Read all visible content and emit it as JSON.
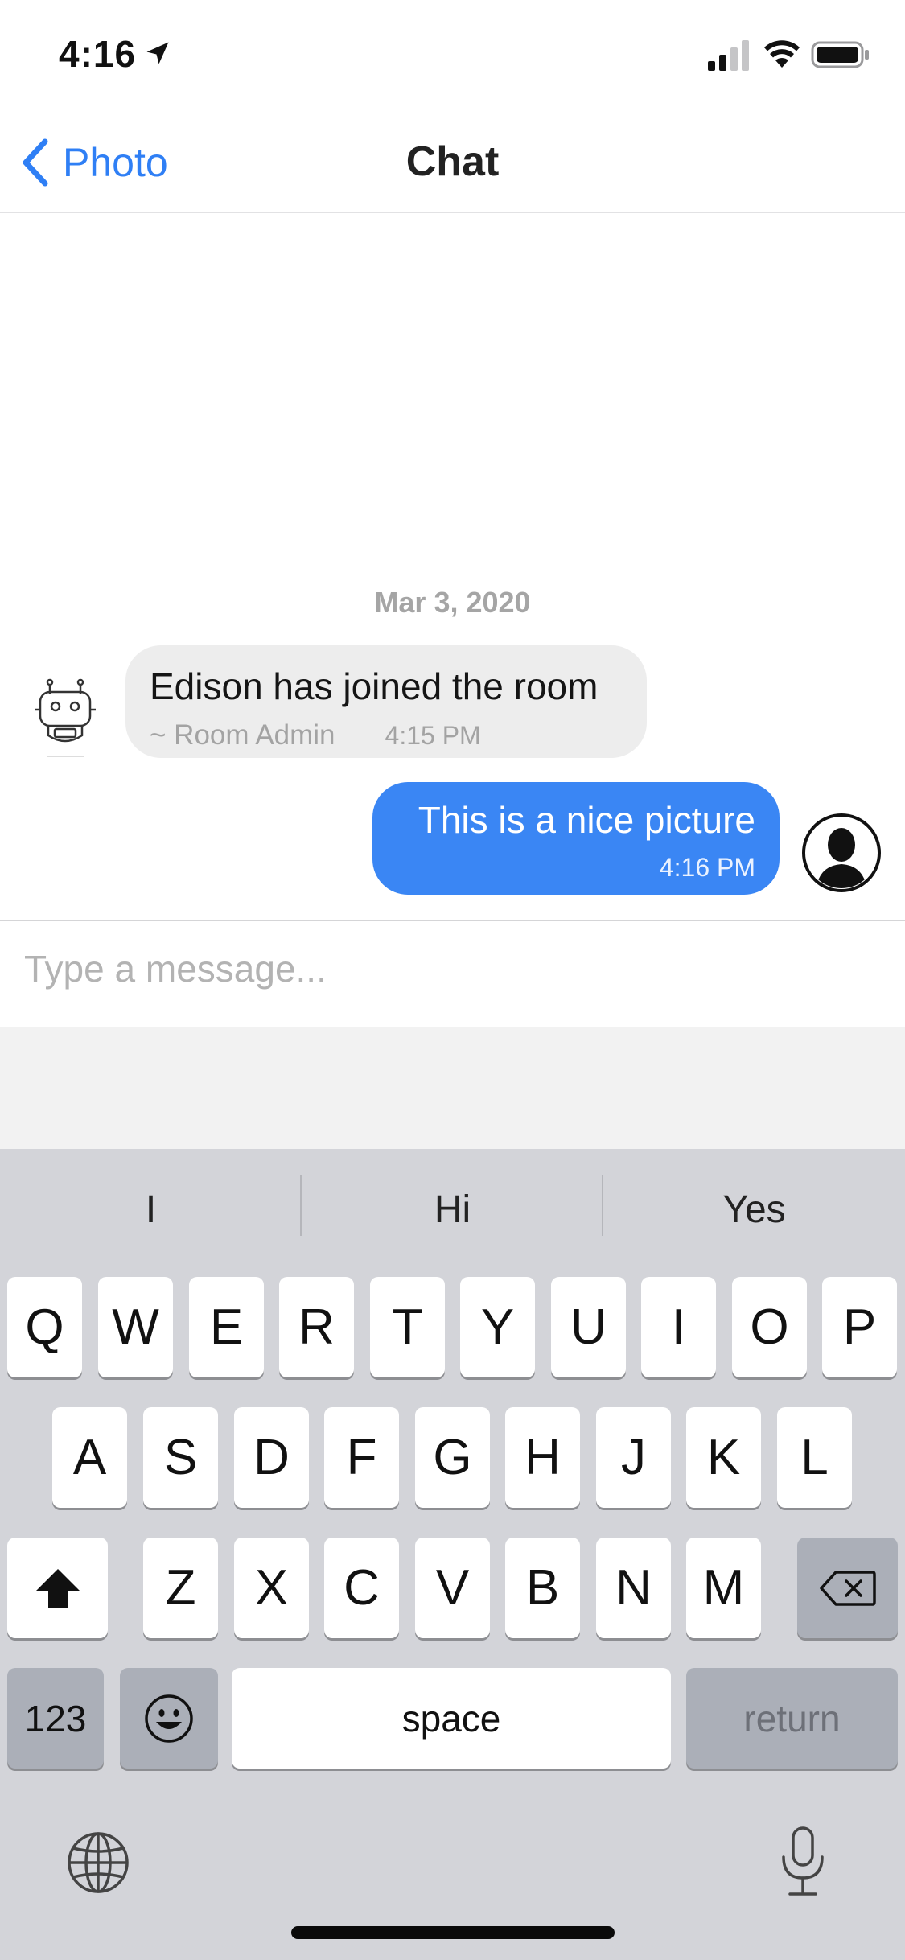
{
  "status_bar": {
    "time": "4:16",
    "icons": [
      "location-arrow-icon",
      "cellular-signal-icon",
      "wifi-icon",
      "battery-icon"
    ]
  },
  "nav": {
    "back_label": "Photo",
    "title": "Chat",
    "accent_color": "#2f7ff5"
  },
  "chat": {
    "date_divider": "Mar 3, 2020",
    "messages": [
      {
        "direction": "incoming",
        "text": "Edison has joined the room",
        "sender": "~ Room Admin",
        "time": "4:15 PM",
        "avatar": "robot-avatar-icon"
      },
      {
        "direction": "outgoing",
        "text": "This is a nice picture",
        "time": "4:16 PM",
        "avatar": "user-avatar-icon",
        "bubble_color": "#3a86f4"
      }
    ]
  },
  "composer": {
    "placeholder": "Type a message...",
    "value": ""
  },
  "keyboard": {
    "suggestions": [
      "I",
      "Hi",
      "Yes"
    ],
    "row1": [
      "Q",
      "W",
      "E",
      "R",
      "T",
      "Y",
      "U",
      "I",
      "O",
      "P"
    ],
    "row2": [
      "A",
      "S",
      "D",
      "F",
      "G",
      "H",
      "J",
      "K",
      "L"
    ],
    "row3": [
      "Z",
      "X",
      "C",
      "V",
      "B",
      "N",
      "M"
    ],
    "numbers_label": "123",
    "space_label": "space",
    "return_label": "return",
    "icons": [
      "shift-icon",
      "delete-icon",
      "emoji-icon",
      "globe-icon",
      "microphone-icon"
    ]
  }
}
